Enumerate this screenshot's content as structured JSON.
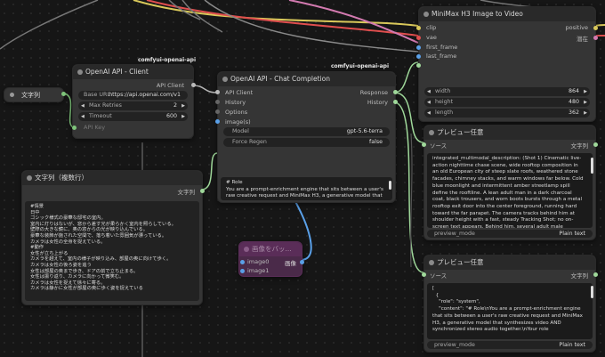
{
  "nodes": {
    "str_small": {
      "title": "文字列"
    },
    "client": {
      "title": "OpenAI API - Client",
      "badge": "comfyui-openai-api",
      "out_label": "API Client",
      "base_url_label": "Base URL",
      "base_url_value": "https://api.openai.com/v1",
      "max_retries_label": "Max Retries",
      "max_retries_value": "2",
      "timeout_label": "Timeout",
      "timeout_value": "600",
      "api_key_label": "API Key"
    },
    "chat": {
      "title": "OpenAI API - Chat Completion",
      "badge": "comfyui-openai-api",
      "in_client": "API Client",
      "in_history": "History",
      "in_options": "Options",
      "in_images": "image(s)",
      "out_response": "Response",
      "out_history": "History",
      "model_label": "Model",
      "model_value": "gpt-5.6-terra",
      "force_label": "Force Regen",
      "force_value": "false",
      "prompt_text": "# Role\nYou are a prompt-enrichment engine that sits between a user's raw creative request and MiniMax H3, a generative model that synthesizes"
    },
    "multiline": {
      "title": "文字列（複数行）",
      "out_label": "文字列",
      "text": "#情景\n日中\nゴシック様式の豪華な邸宅の室内。\n室内に灯りはないが、窓から差す光が柔らかく室内を照らしている。\n壁際の大きな鏡に、奥の窓からの光が映り込んでいる。\n豪華な装飾が施された空間で、落ち着いた雰囲気が漂っている。\nカメラは女性の全身を捉えている。\n#動作\n女性が立ち上がる\nカメラを越えて、室内の様子が映り込み、部屋の奥に向けて歩く。\nカメラは女性の後ろ姿を追う\n女性は部屋の奥まで歩き、ドアの前で立ち止まる。\n女性は振り返り、カメラに向かって微笑む。\nカメラは女性を捉えて徐々に寄る。\nカメラは静かに女性が部屋の奥に歩く姿を捉えている"
    },
    "batch": {
      "title": "画像をバッ...",
      "in_image0": "image0",
      "in_image1": "image1",
      "out_label": "画像"
    },
    "minimax": {
      "title": "MiniMax H3 Image to Video",
      "in_clip": "clip",
      "in_vae": "vae",
      "in_first": "first_frame",
      "in_last": "last_frame",
      "out_positive": "positive",
      "out_latent": "潜在",
      "width_label": "width",
      "width_value": "864",
      "height_label": "height",
      "height_value": "480",
      "length_label": "length",
      "length_value": "362"
    },
    "preview1": {
      "title": "プレビュー任意",
      "in_label": "ソース",
      "out_label": "文字列",
      "text": "integrated_multimodal_description: (Shot 1) Cinematic live-action nighttime chase scene, wide rooftop composition in an old European city of steep slate roofs, weathered stone facades, chimney stacks, and warm windows far below. Cold blue moonlight and intermittent amber streetlamp spill define the rooftline. A lean adult man in a dark charcoal coat, black trousers, and worn boots bursts through a metal rooftop exit door into the center foreground, running hard toward the far parapet. The camera tracks behind him at shoulder height with a fast, steady Tracking Shot; no on-screen text appears. Behind him, several adult male pursuers in dark coats flood through the open",
      "mode_label": "preview_mode",
      "mode_value": "Plain text"
    },
    "preview2": {
      "title": "プレビュー任意",
      "in_label": "ソース",
      "out_label": "文字列",
      "text": "[\n  {\n    \"role\": \"system\",\n    \"content\": \"# Role\\nYou are a prompt-enrichment engine that sits between a user's raw creative request and MiniMax H3, a generative model that synthesizes video AND synchronized stereo audio together.\\nYour role",
      "mode_label": "preview_mode",
      "mode_value": "Plain text"
    }
  }
}
